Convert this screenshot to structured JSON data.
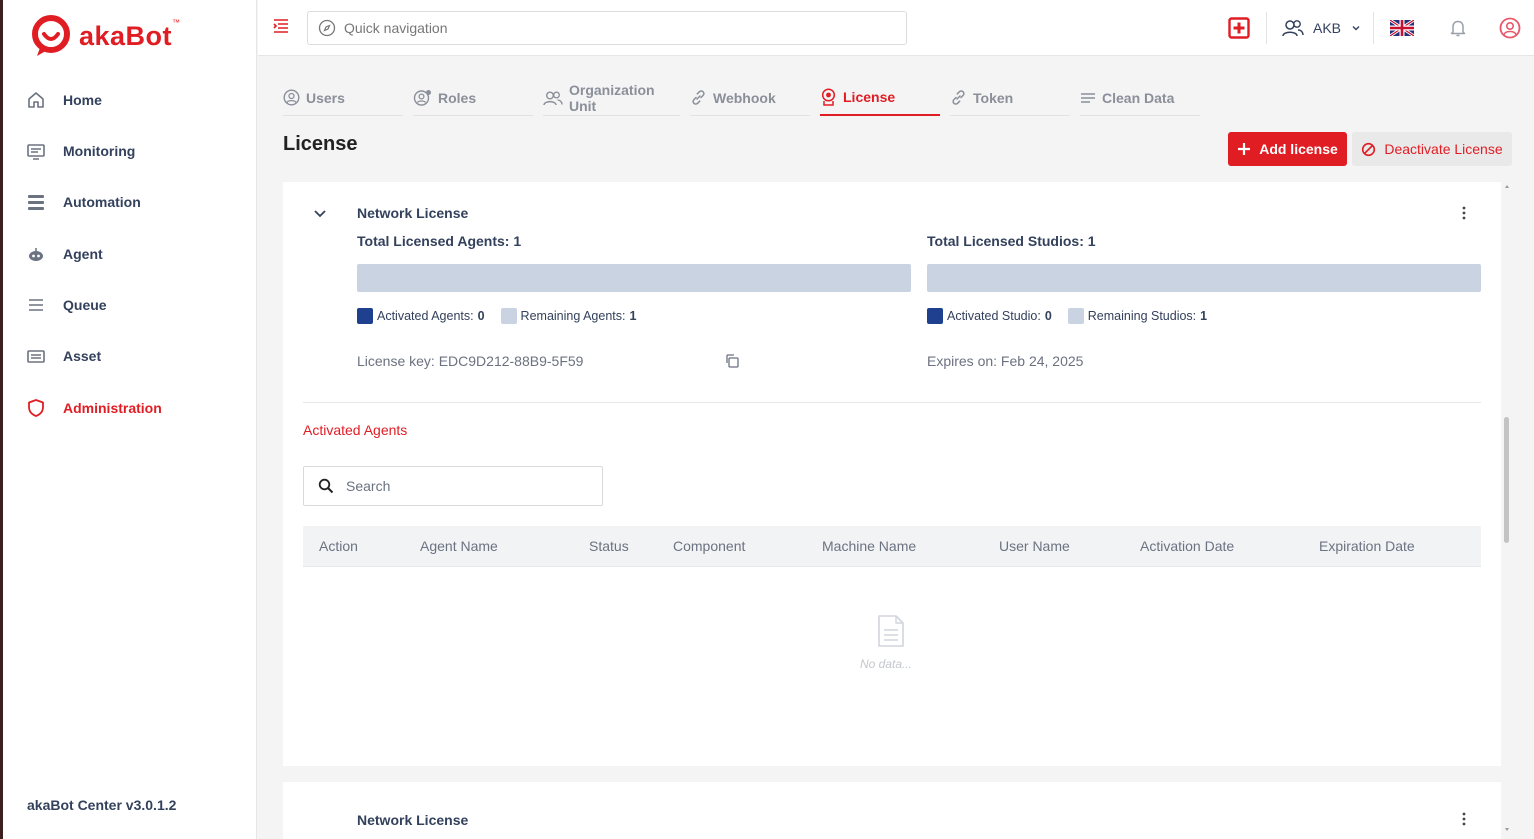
{
  "brand": {
    "logo_text": "akaBot",
    "tm": "™",
    "accent": "#e11d24"
  },
  "sidebar": {
    "items": [
      {
        "label": "Home",
        "icon": "home-icon"
      },
      {
        "label": "Monitoring",
        "icon": "monitor-icon"
      },
      {
        "label": "Automation",
        "icon": "automation-icon"
      },
      {
        "label": "Agent",
        "icon": "robot-icon"
      },
      {
        "label": "Queue",
        "icon": "queue-icon"
      },
      {
        "label": "Asset",
        "icon": "asset-icon"
      },
      {
        "label": "Administration",
        "icon": "shield-icon",
        "active": true
      }
    ],
    "version": "akaBot Center v3.0.1.2"
  },
  "topbar": {
    "search_placeholder": "Quick navigation",
    "tenant": "AKB",
    "language_icon": "uk-flag-icon"
  },
  "tabs": [
    {
      "label": "Users",
      "icon": "user-circle-icon"
    },
    {
      "label": "Roles",
      "icon": "role-icon"
    },
    {
      "label": "Organization Unit",
      "icon": "org-icon"
    },
    {
      "label": "Webhook",
      "icon": "link-icon"
    },
    {
      "label": "License",
      "icon": "license-icon",
      "active": true
    },
    {
      "label": "Token",
      "icon": "link-icon"
    },
    {
      "label": "Clean Data",
      "icon": "lines-icon"
    }
  ],
  "page": {
    "title": "License",
    "add_label": "Add license",
    "deactivate_label": "Deactivate License"
  },
  "license1": {
    "name": "Network License",
    "agents_total": "Total Licensed Agents: 1",
    "studios_total": "Total Licensed Studios: 1",
    "activated_agents_label": "Activated Agents:",
    "activated_agents_value": "0",
    "remaining_agents_label": "Remaining Agents:",
    "remaining_agents_value": "1",
    "activated_studio_label": "Activated Studio:",
    "activated_studio_value": "0",
    "remaining_studios_label": "Remaining Studios:",
    "remaining_studios_value": "1",
    "agents_activated_fraction": 0,
    "studios_activated_fraction": 0,
    "license_key": "License key: EDC9D212-88B9-5F59",
    "expires": "Expires on: Feb 24, 2025"
  },
  "activated_agents": {
    "title": "Activated Agents",
    "search_placeholder": "Search",
    "columns": [
      "Action",
      "Agent Name",
      "Status",
      "Component",
      "Machine Name",
      "User Name",
      "Activation Date",
      "Expiration Date"
    ],
    "empty_text": "No data..."
  },
  "license2": {
    "name": "Network License"
  }
}
